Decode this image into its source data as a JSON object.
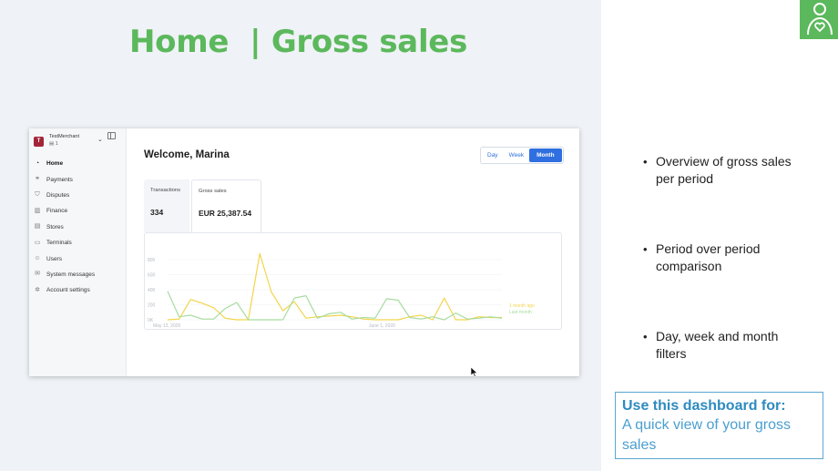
{
  "slide": {
    "title": "Home  | Gross sales",
    "accent_color": "#5cb85c",
    "user_badge_icon": "user-heart-icon"
  },
  "app": {
    "merchant": {
      "logo_letter": "T",
      "name": "TestMerchant",
      "store_count": "1"
    },
    "nav": [
      {
        "label": "Home",
        "icon": "home-icon",
        "active": true
      },
      {
        "label": "Payments",
        "icon": "payments-icon"
      },
      {
        "label": "Disputes",
        "icon": "shield-icon"
      },
      {
        "label": "Finance",
        "icon": "bar-chart-icon"
      },
      {
        "label": "Stores",
        "icon": "store-icon"
      },
      {
        "label": "Terminals",
        "icon": "terminal-icon"
      },
      {
        "label": "Users",
        "icon": "users-icon"
      },
      {
        "label": "System messages",
        "icon": "mail-icon"
      },
      {
        "label": "Account settings",
        "icon": "gear-icon"
      }
    ],
    "welcome": "Welcome, Marina",
    "period": {
      "options": [
        "Day",
        "Week",
        "Month"
      ],
      "selected": "Month"
    },
    "tabs": [
      {
        "label": "Transactions",
        "value": "334"
      },
      {
        "label": "Gross sales",
        "value": "EUR 25,387.54"
      }
    ]
  },
  "chart_data": {
    "type": "line",
    "y_ticks": [
      "800",
      "600",
      "400",
      "200",
      "0K"
    ],
    "ylim": [
      0,
      800
    ],
    "x_labels": [
      "May 13, 2020",
      "June 1, 2020"
    ],
    "series": [
      {
        "name": "1 month ago",
        "color": "#f2d54b",
        "values": [
          0,
          10,
          270,
          220,
          160,
          20,
          0,
          0,
          880,
          370,
          120,
          240,
          20,
          40,
          50,
          60,
          40,
          10,
          0,
          0,
          0,
          40,
          60,
          0,
          290,
          0,
          0,
          40,
          30,
          30
        ]
      },
      {
        "name": "Last month",
        "color": "#a8dca0",
        "values": [
          380,
          40,
          60,
          10,
          10,
          150,
          230,
          0,
          0,
          0,
          0,
          290,
          320,
          20,
          80,
          100,
          10,
          30,
          20,
          280,
          260,
          30,
          10,
          40,
          0,
          90,
          10,
          20,
          40,
          20
        ]
      }
    ],
    "legend_position": "right"
  },
  "bullets": [
    "Overview of gross sales per period",
    "Period over period comparison",
    "Day, week and month filters"
  ],
  "callout": {
    "heading": "Use this dashboard for:",
    "body": "A quick view of your gross sales"
  }
}
